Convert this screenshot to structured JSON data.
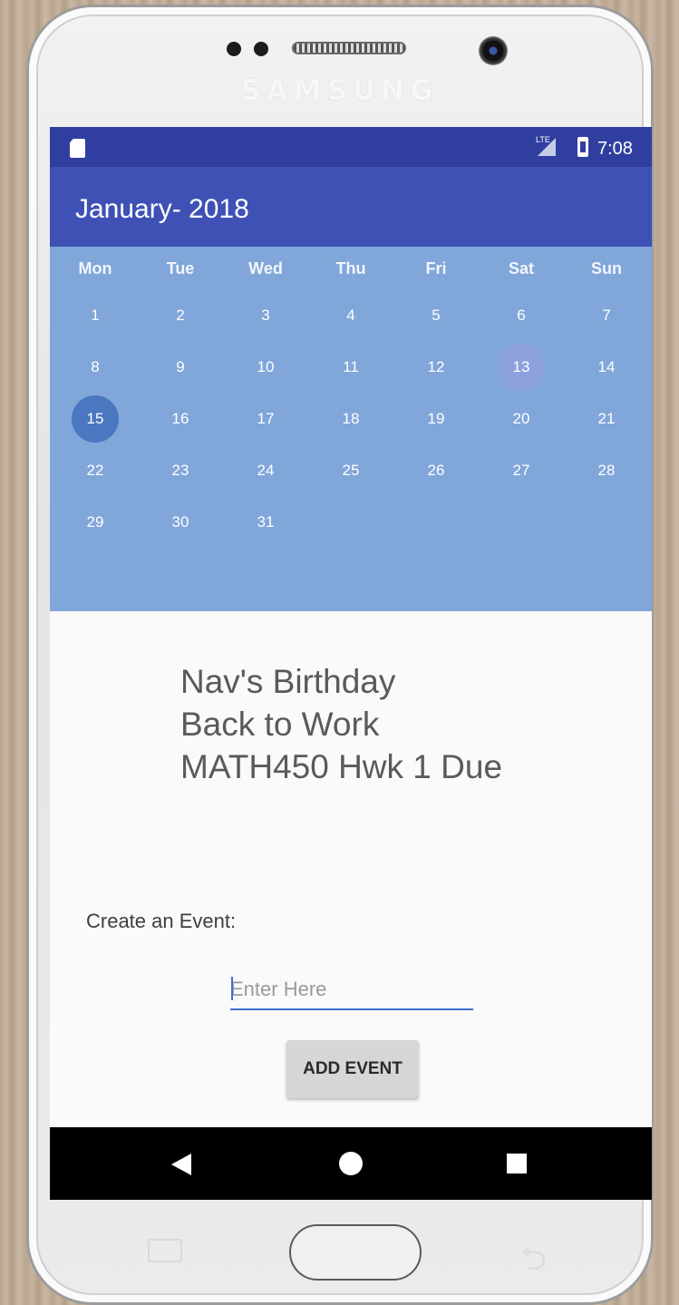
{
  "device": {
    "brand": "SAMSUNG"
  },
  "status_bar": {
    "network": "LTE",
    "time": "7:08",
    "icons": [
      "sd-card-icon",
      "signal-icon",
      "battery-icon"
    ]
  },
  "app_bar": {
    "title": "January- 2018"
  },
  "calendar": {
    "weekdays": [
      "Mon",
      "Tue",
      "Wed",
      "Thu",
      "Fri",
      "Sat",
      "Sun"
    ],
    "weeks": [
      [
        "1",
        "2",
        "3",
        "4",
        "5",
        "6",
        "7"
      ],
      [
        "8",
        "9",
        "10",
        "11",
        "12",
        "13",
        "14"
      ],
      [
        "15",
        "16",
        "17",
        "18",
        "19",
        "20",
        "21"
      ],
      [
        "22",
        "23",
        "24",
        "25",
        "26",
        "27",
        "28"
      ],
      [
        "29",
        "30",
        "31",
        "",
        "",
        "",
        ""
      ]
    ],
    "selected_day": "15",
    "today_day": "13"
  },
  "events": [
    "Nav's Birthday",
    "Back to Work",
    "MATH450 Hwk 1 Due"
  ],
  "create_event": {
    "label": "Create an Event:",
    "placeholder": "Enter Here",
    "value": "",
    "button_label": "ADD EVENT"
  },
  "nav_bar": {
    "icons": [
      "back-icon",
      "home-icon",
      "recents-icon"
    ]
  },
  "colors": {
    "status_bar": "#303f9f",
    "app_bar": "#3f51b5",
    "calendar_bg": "#80a6da",
    "selected_day": "#4a77c0",
    "today_day": "#8ca0dd",
    "input_underline": "#3f6fd0"
  }
}
